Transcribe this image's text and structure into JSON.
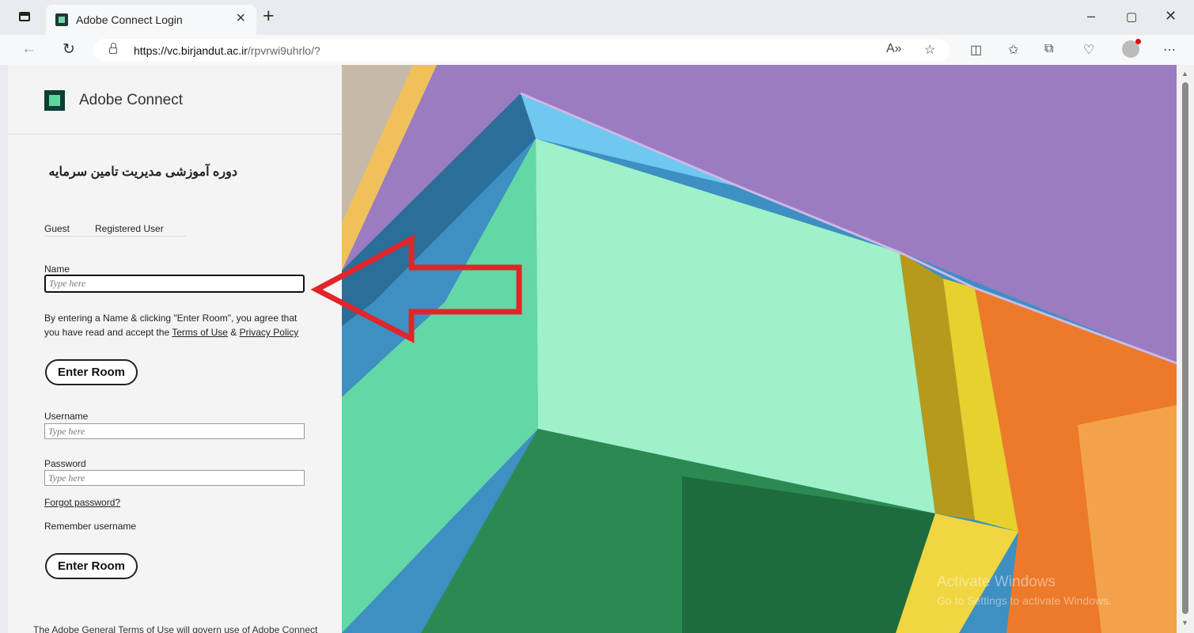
{
  "browser": {
    "tab_title": "Adobe Connect Login",
    "url_host": "https://vc.birjandut.ac.ir",
    "url_path": "/rpvrwi9uhrlo/?"
  },
  "panel": {
    "logo_text": "Adobe Connect",
    "room_title": "دوره آموزشی مدیریت تامین سرمایه",
    "tabs": [
      "Guest",
      "Registered User"
    ],
    "name_label": "Name",
    "name_placeholder": "Type here",
    "agree_prefix": "By entering a Name & clicking \"Enter Room\", you agree that you have read and accept the ",
    "terms_link": "Terms of Use",
    "agree_and": " & ",
    "privacy_link": "Privacy Policy",
    "enter_room_guest": "Enter Room",
    "username_label": "Username",
    "username_placeholder": "Type here",
    "password_label": "Password",
    "password_placeholder": "Type here",
    "forgot_password": "Forgot password?",
    "remember_username": "Remember username",
    "enter_room_registered": "Enter Room",
    "footer_note": "The Adobe General Terms of Use will govern use of Adobe Connect"
  },
  "watermark": {
    "line1": "Activate Windows",
    "line2": "Go to Settings to activate Windows."
  }
}
